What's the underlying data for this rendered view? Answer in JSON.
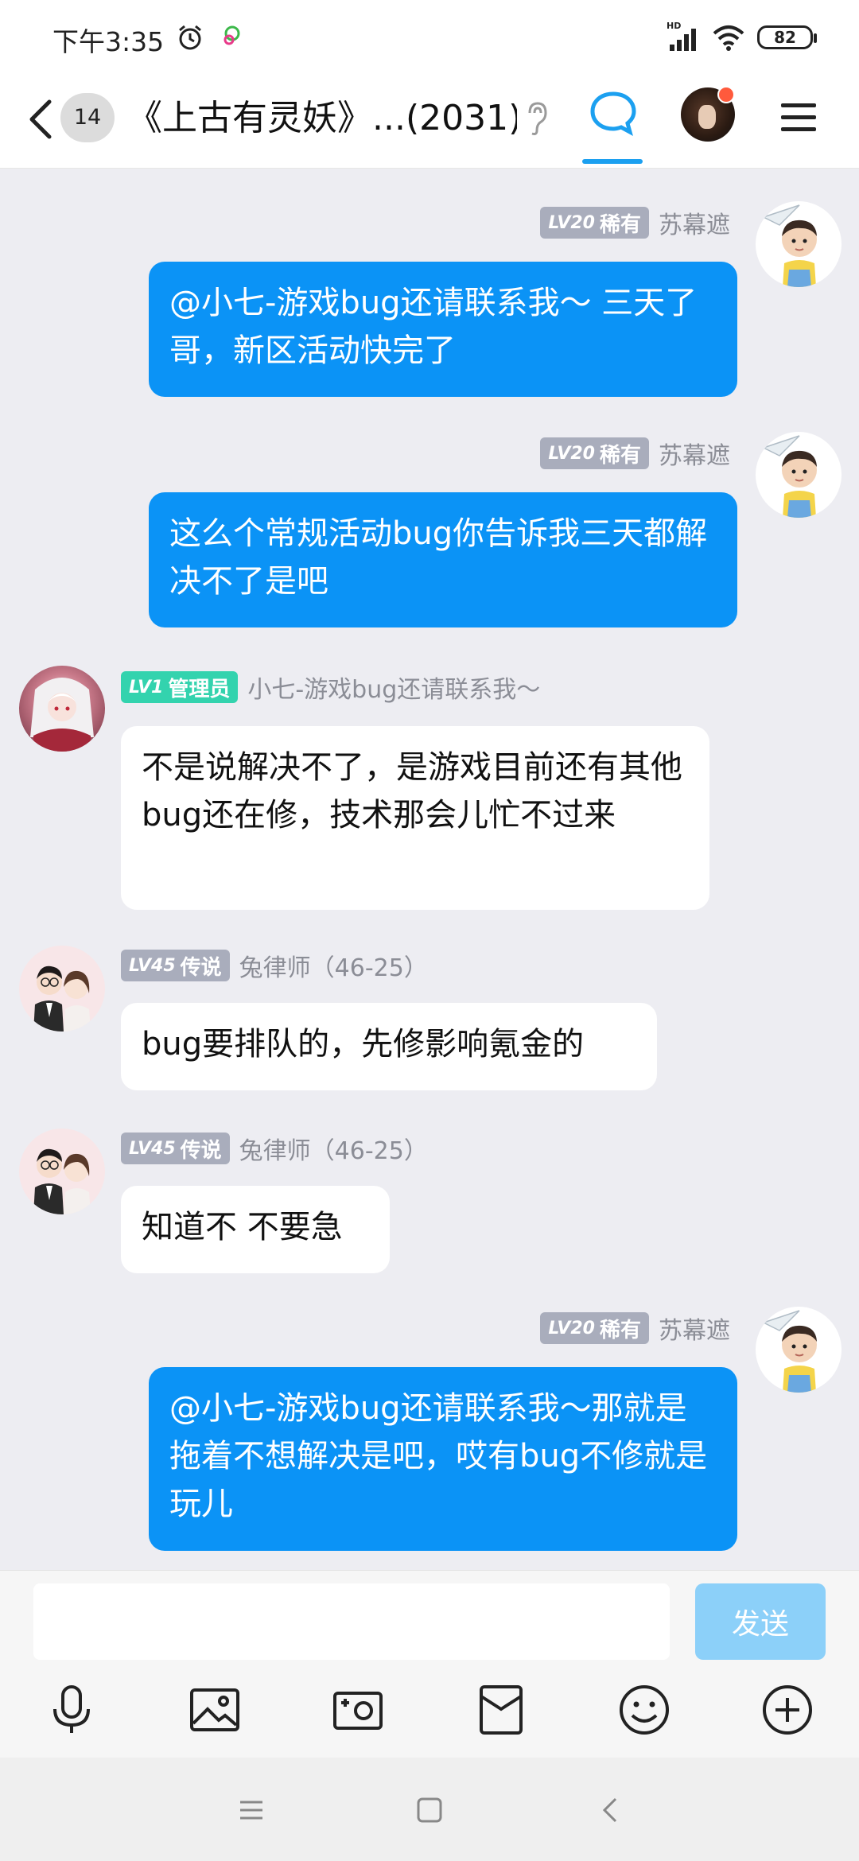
{
  "status_bar": {
    "time": "下午3:35",
    "battery": "82",
    "network": "HD"
  },
  "header": {
    "unread_count": "14",
    "title": "《上古有灵妖》...(2031)",
    "accent": "#1ca0f0"
  },
  "messages": [
    {
      "side": "right",
      "badge_level": "LV20",
      "badge_title": "稀有",
      "badge_color": "gray",
      "sender": "苏幕遮",
      "text": "@小七-游戏bug还请联系我～ 三天了哥，新区活动快完了"
    },
    {
      "side": "right",
      "badge_level": "LV20",
      "badge_title": "稀有",
      "badge_color": "gray",
      "sender": "苏幕遮",
      "text": "这么个常规活动bug你告诉我三天都解决不了是吧"
    },
    {
      "side": "left",
      "badge_level": "LV1",
      "badge_title": "管理员",
      "badge_color": "green",
      "sender": "小七-游戏bug还请联系我～",
      "text": "不是说解决不了，是游戏目前还有其他bug还在修，技术那会儿忙不过来"
    },
    {
      "side": "left",
      "badge_level": "LV45",
      "badge_title": "传说",
      "badge_color": "gray",
      "sender": "兔律师（46-25）",
      "text": "bug要排队的，先修影响氪金的"
    },
    {
      "side": "left",
      "badge_level": "LV45",
      "badge_title": "传说",
      "badge_color": "gray",
      "sender": "兔律师（46-25）",
      "text": "知道不 不要急"
    },
    {
      "side": "right",
      "badge_level": "LV20",
      "badge_title": "稀有",
      "badge_color": "gray",
      "sender": "苏幕遮",
      "text": "@小七-游戏bug还请联系我～那就是拖着不想解决是吧，哎有bug不修就是玩儿"
    }
  ],
  "input": {
    "placeholder": "",
    "send_label": "发送"
  },
  "toolbar": {
    "icons": [
      "microphone-icon",
      "image-icon",
      "camera-icon",
      "red-packet-icon",
      "emoji-icon",
      "plus-icon"
    ]
  },
  "colors": {
    "my_bubble": "#0b93f6",
    "other_bubble": "#ffffff",
    "background": "#ededf2",
    "send_disabled": "#8cd0f9"
  }
}
